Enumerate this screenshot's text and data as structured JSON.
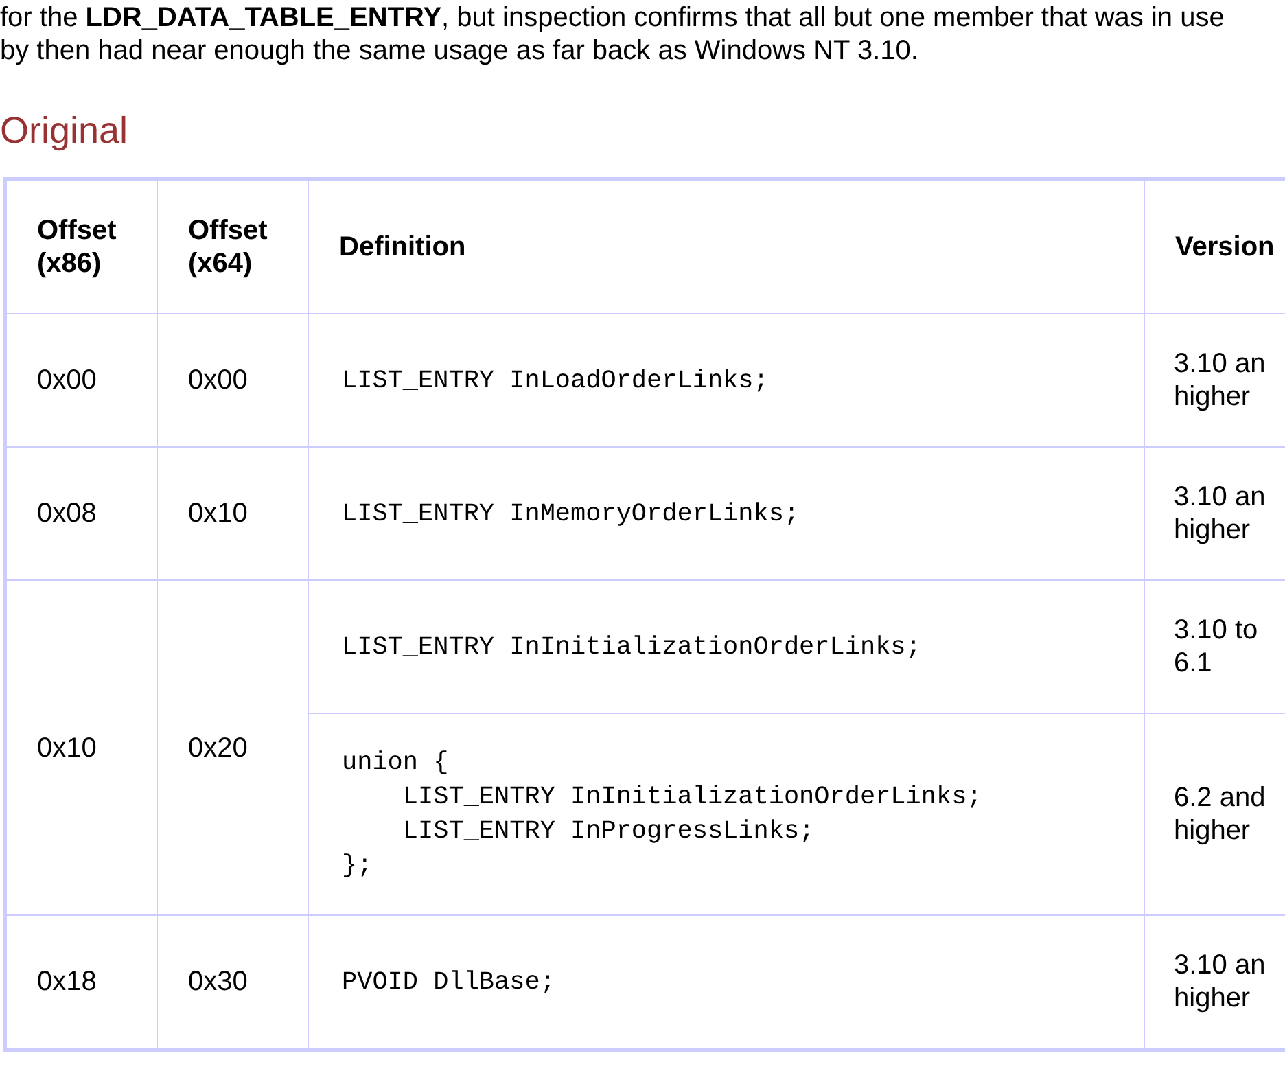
{
  "intro": "for the **LDR_DATA_TABLE_ENTRY**, but inspection confirms that all but one member that was in use by then had near enough the same usage as far back as Windows NT 3.10.",
  "heading": "Original",
  "table": {
    "columns": [
      "Offset (x86)",
      "Offset (x64)",
      "Definition",
      "Version"
    ],
    "rows": [
      {
        "offset_x86": "0x00",
        "offset_x64": "0x00",
        "members": [
          {
            "definition": "LIST_ENTRY InLoadOrderLinks;",
            "versions": "3.10 an higher"
          }
        ]
      },
      {
        "offset_x86": "0x08",
        "offset_x64": "0x10",
        "members": [
          {
            "definition": "LIST_ENTRY InMemoryOrderLinks;",
            "versions": "3.10 an higher"
          }
        ]
      },
      {
        "offset_x86": "0x10",
        "offset_x64": "0x20",
        "members": [
          {
            "definition": "LIST_ENTRY InInitializationOrderLinks;",
            "versions": "3.10 to 6.1"
          },
          {
            "definition": "union {\n    LIST_ENTRY InInitializationOrderLinks;\n    LIST_ENTRY InProgressLinks;\n};",
            "versions": "6.2 and higher"
          }
        ]
      },
      {
        "offset_x86": "0x18",
        "offset_x64": "0x30",
        "members": [
          {
            "definition": "PVOID DllBase;",
            "versions": "3.10 an higher"
          }
        ]
      }
    ]
  }
}
